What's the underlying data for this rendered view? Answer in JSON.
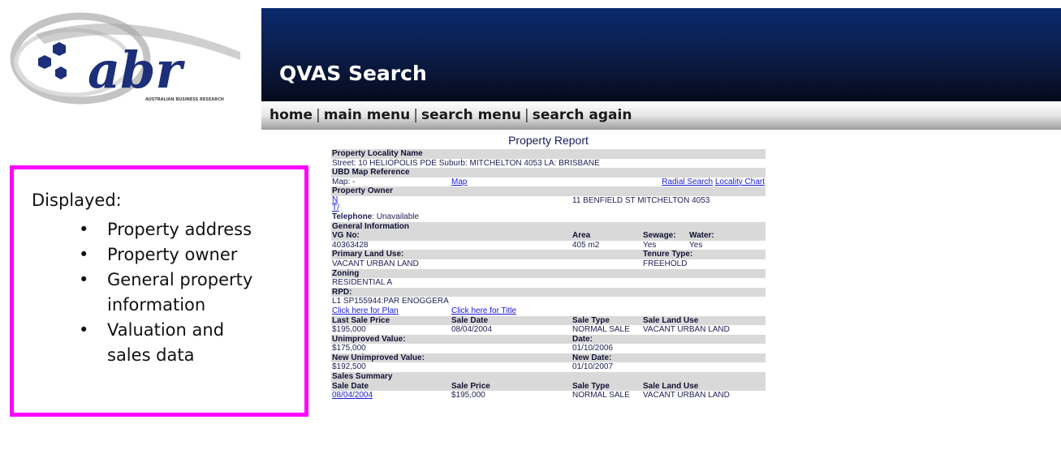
{
  "logo": {
    "text": "abr",
    "subtext": "AUSTRALIAN BUSINESS RESEARCH"
  },
  "header": {
    "title": "QVAS Search"
  },
  "nav": {
    "home": "home",
    "main_menu": "main menu",
    "search_menu": "search menu",
    "search_again": "search again",
    "separator": "|"
  },
  "report": {
    "title": "Property Report",
    "locality_header": "Property Locality Name",
    "locality_value": "Street: 10 HELIOPOLIS PDE Suburb: MITCHELTON 4053 LA: BRISBANE",
    "ubd_header": "UBD Map Reference",
    "map_value": "Map: -",
    "map_link": "Map",
    "radial_link": "Radial Search",
    "locality_chart_link": "Locality Chart",
    "owner_header": "Property Owner",
    "owner_name_link": "N",
    "owner_ta_link": "T/",
    "owner_address": "11 BENFIELD ST MITCHELTON 4053",
    "telephone_label": "Telephone",
    "telephone_value": ": Unavailable",
    "general_header": "General Information",
    "vg_no_label": "VG No:",
    "area_label": "Area",
    "sewage_label": "Sewage:",
    "water_label": "Water:",
    "vg_no": "40363428",
    "area": "405 m2",
    "sewage": "Yes",
    "water": "Yes",
    "land_use_label": "Primary Land Use:",
    "tenure_label": "Tenure Type:",
    "land_use": "VACANT URBAN LAND",
    "tenure": "FREEHOLD",
    "zoning_label": "Zoning",
    "zoning": "RESIDENTIAL A",
    "rpd_label": "RPD:",
    "rpd": "L1 SP155944:PAR ENOGGERA",
    "plan_link": "Click here for Plan",
    "title_link": "Click here for Title",
    "last_sale_price_label": "Last Sale Price",
    "sale_date_label": "Sale Date",
    "sale_type_label": "Sale Type",
    "sale_land_use_label": "Sale Land Use",
    "last_sale_price": "$195,000",
    "sale_date": "08/04/2004",
    "sale_type": "NORMAL SALE",
    "sale_land_use": "VACANT URBAN LAND",
    "unimproved_label": "Unimproved Value:",
    "date_label": "Date:",
    "unimproved": "$175,000",
    "unimproved_date": "01/10/2006",
    "new_unimproved_label": "New Unimproved Value:",
    "new_date_label": "New Date:",
    "new_unimproved": "$192,500",
    "new_date": "01/10/2007",
    "sales_summary_header": "Sales Summary",
    "summary_sale_date_label": "Sale Date",
    "summary_sale_price_label": "Sale Price",
    "summary_sale_type_label": "Sale Type",
    "summary_sale_land_use_label": "Sale Land Use",
    "summary_sale_date": "08/04/2004",
    "summary_sale_price": "$195,000",
    "summary_sale_type": "NORMAL SALE",
    "summary_sale_land_use": "VACANT URBAN LAND"
  },
  "callout": {
    "heading": "Displayed:",
    "bullet": "•",
    "items": [
      "Property address",
      "Property owner",
      "General property",
      "information",
      "Valuation and",
      "sales data"
    ]
  },
  "colors": {
    "callout_border": "#ff00ff",
    "banner_top": "#0a2a6e",
    "banner_bottom": "#060b1c",
    "section_header": "#d9d9d9",
    "link": "#1a1ad0"
  }
}
